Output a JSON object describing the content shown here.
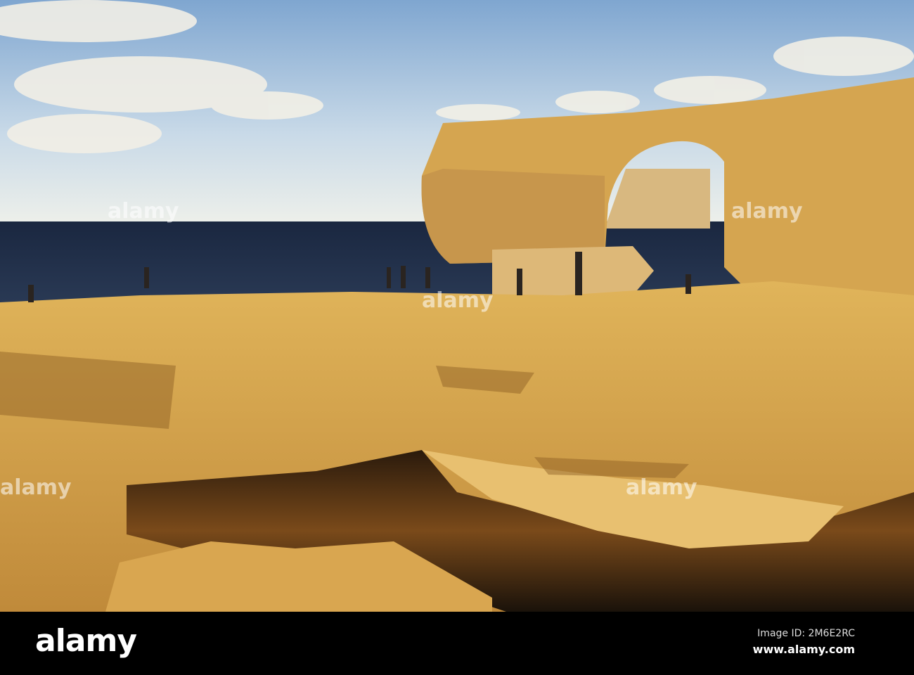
{
  "photo": {
    "alt_subject": "Sea arch on rocky limestone coast at sunset"
  },
  "watermark": {
    "text": "alamy"
  },
  "footer": {
    "logo": "alamy",
    "image_id": "Image ID: 2M6E2RC",
    "website": "www.alamy.com"
  },
  "colors": {
    "sky_top": "#7fa6d0",
    "sea": "#1b2a45",
    "rock": "#d9a54a",
    "bar": "#000000"
  }
}
